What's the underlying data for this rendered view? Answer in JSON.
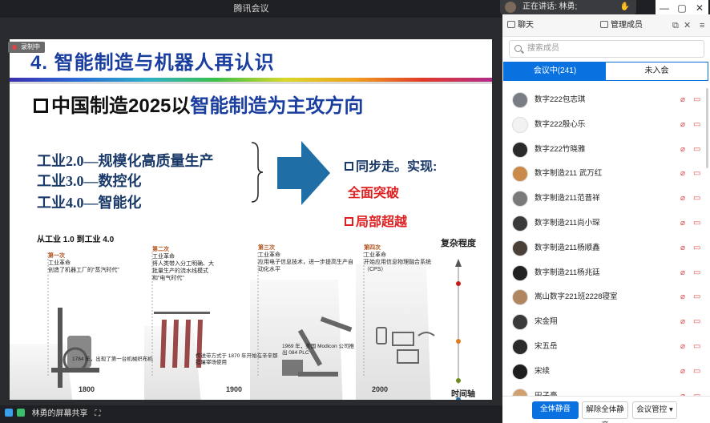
{
  "app": {
    "title": "腾讯会议",
    "speaking_label": "正在讲话: 林勇;",
    "share_label": "林勇的屏幕共享"
  },
  "recording_badge": "录制中",
  "slide": {
    "title": "4. 智能制造与机器人再认识",
    "heading_prefix": "中国制造2025以",
    "heading_highlight": "智能制造为主攻方向",
    "gens": [
      "工业2.0—规模化高质量生产",
      "工业3.0—数控化",
      "工业4.0—智能化"
    ],
    "right_1": "同步走。实现:",
    "right_2": "全面突破",
    "right_3": "局部超越",
    "industry_title": "从工业 1.0 到工业 4.0",
    "complexity": "复杂程度",
    "axis_label": "时间轴",
    "years": [
      "1800",
      "1900",
      "2000"
    ],
    "eras": [
      {
        "n": "第一次",
        "a": "工业革命",
        "d": "创造了机器工厂的“蒸汽时代”"
      },
      {
        "n": "第二次",
        "a": "工业革命",
        "d": "将人类带入分工明确、大批量生产的流水线模式和“电气时代”"
      },
      {
        "n": "第三次",
        "a": "工业革命",
        "d": "应用电子信息技术，进一步提高生产自动化水平"
      },
      {
        "n": "第四次",
        "a": "工业革命",
        "d": "开始应用信息物理融合系统（CPS）"
      }
    ],
    "notes": [
      "1784 年，出现了第一台机械织布机",
      "传送带方式于 1870 年开始在辛辛那提屠宰场使用",
      "1969 年，美国 Modicon 公司推出 084 PLC"
    ]
  },
  "panel": {
    "tab_chat": "聊天",
    "tab_members": "管理成员",
    "search_placeholder": "搜索成员",
    "seg_in": "会议中(241)",
    "seg_out": "未入会",
    "members": [
      {
        "name": "数字222包志琪",
        "color": "#7a7d86"
      },
      {
        "name": "数字222殷心乐",
        "color": "#f2f2f2"
      },
      {
        "name": "数字222竹晓雅",
        "color": "#2a2a2a"
      },
      {
        "name": "数字制造211 武万红",
        "color": "#c98a4a"
      },
      {
        "name": "数字制造211范晋祥",
        "color": "#7a7a7a"
      },
      {
        "name": "数字制造211尚小琛",
        "color": "#3a3a3a"
      },
      {
        "name": "数字制造211杨顺鑫",
        "color": "#4a4038"
      },
      {
        "name": "数字制造211杨兆廷",
        "color": "#222222"
      },
      {
        "name": "嵩山数字221班2228寝室",
        "color": "#b08660"
      },
      {
        "name": "宋金翔",
        "color": "#3a3a3a"
      },
      {
        "name": "宋五岳",
        "color": "#2b2b2b"
      },
      {
        "name": "宋续",
        "color": "#1e1e1e"
      },
      {
        "name": "田子豪",
        "color": "#d0a070"
      }
    ],
    "btn_mute_all": "全体静音",
    "btn_unmute_all": "解除全体静音",
    "btn_control": "会议管控"
  }
}
